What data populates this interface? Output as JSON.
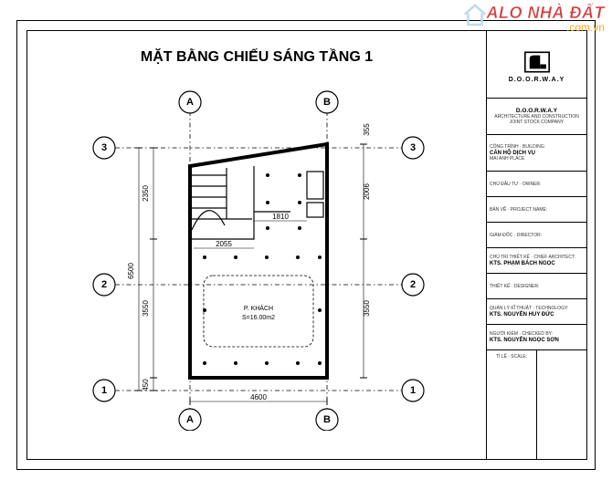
{
  "watermark": {
    "line1": "ALO NHÀ ĐẤT",
    "line2": ".com.vn"
  },
  "title": "MẶT BẰNG CHIẾU SÁNG TẦNG 1",
  "grid_labels": {
    "colA": "A",
    "colB": "B",
    "row1": "1",
    "row2": "2",
    "row3": "3"
  },
  "dims": {
    "w_total": "4600",
    "h_total": "6500",
    "seg_450": "450",
    "seg_3550": "3550",
    "seg_2350": "2350",
    "seg_2006": "2006",
    "seg_2055": "2055",
    "seg_1810": "1810",
    "seg_355": "355"
  },
  "rooms": {
    "pkhach_name": "P. KHÁCH",
    "pkhach_area": "S=16.00m2"
  },
  "sidebar": {
    "brand": "D.O.O.R.W.A.Y",
    "brand_sub1": "ARCHITECTURE AND CONSTRUCTION",
    "brand_sub2": "JOINT STOCK COMPANY",
    "project_label": "CÔNG TRÌNH · BUILDING:",
    "project": "CĂN HỘ DỊCH VỤ",
    "project2": "MAI ANH PLACE",
    "owner_label": "CHỦ ĐẦU TƯ · OWNER:",
    "drawing_label": "BẢN VẼ · PROJECT NAME:",
    "director_label": "GIÁM ĐỐC · DIRECTOR:",
    "architect_label": "CHỦ TRÌ THIẾT KẾ · CHIEF ARCHITECT:",
    "architect": "KTS. PHẠM BÁCH NGỌC",
    "designer_label": "THIẾT KẾ · DESIGNER:",
    "tech_label": "QUẢN LÝ KĨ THUẬT · TECHNOLOGY:",
    "tech": "KTS. NGUYỄN HUY ĐỨC",
    "check_label": "NGƯỜI KIỂM · CHECKED BY:",
    "check": "KTS. NGUYỄN NGỌC SƠN",
    "scale_label": "TỈ LỆ · SCALE:"
  }
}
